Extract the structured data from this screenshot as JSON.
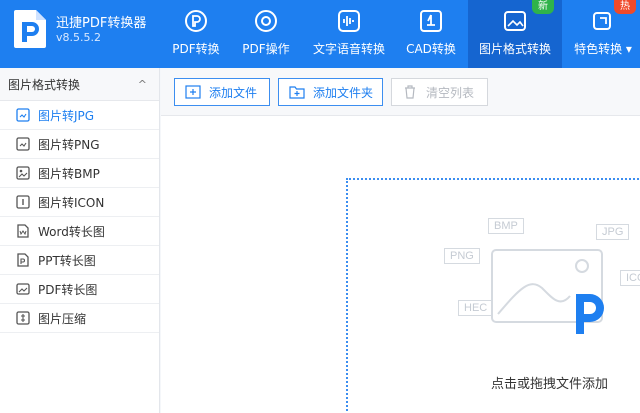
{
  "app": {
    "title": "迅捷PDF转换器",
    "version": "v8.5.5.2"
  },
  "nav": {
    "tabs": [
      {
        "label": "PDF转换"
      },
      {
        "label": "PDF操作"
      },
      {
        "label": "文字语音转换"
      },
      {
        "label": "CAD转换"
      },
      {
        "label": "图片格式转换",
        "badge": "新",
        "active": true
      },
      {
        "label": "特色转换 ▾",
        "badge": "热"
      }
    ]
  },
  "sidebar": {
    "header": "图片格式转换",
    "collapse_glyph": "^",
    "items": [
      {
        "label": "图片转JPG",
        "active": true
      },
      {
        "label": "图片转PNG"
      },
      {
        "label": "图片转BMP"
      },
      {
        "label": "图片转ICON"
      },
      {
        "label": "Word转长图"
      },
      {
        "label": "PPT转长图"
      },
      {
        "label": "PDF转长图"
      },
      {
        "label": "图片压缩"
      }
    ]
  },
  "toolbar": {
    "add_file": "添加文件",
    "add_folder": "添加文件夹",
    "clear_list": "清空列表"
  },
  "dropzone": {
    "text": "点击或拖拽文件添加",
    "tags": [
      "BMP",
      "JPG",
      "PNG",
      "ICO",
      "HEC"
    ]
  },
  "colors": {
    "accent": "#1e7ff0",
    "accent_dark": "#1565d0",
    "new_badge": "#2fb34a",
    "hot_badge": "#f04a2a"
  }
}
